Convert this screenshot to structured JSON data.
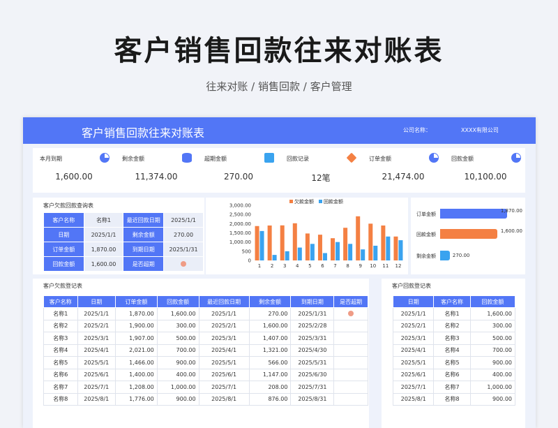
{
  "hero": {
    "title": "客户销售回款往来对账表",
    "subtitle": "往来对账 / 销售回款 / 客户管理"
  },
  "banner": {
    "title": "客户销售回款往来对账表",
    "company_label": "公司名称：",
    "company_value": "XXXX有限公司"
  },
  "colors": {
    "accent": "#5276f6",
    "orange": "#f48043",
    "light_blue": "#3aa3ef",
    "overdue_dot": "#ef9c86"
  },
  "kpis": [
    {
      "label": "本月到期",
      "value": "1,600.00",
      "icon": "pie-chart-icon"
    },
    {
      "label": "剩余金额",
      "value": "11,374.00",
      "icon": "database-icon"
    },
    {
      "label": "超期金额",
      "value": "270.00",
      "icon": "clipboard-icon"
    },
    {
      "label": "回款记录",
      "value": "12笔",
      "icon": "box-icon"
    },
    {
      "label": "订单金额",
      "value": "21,474.00",
      "icon": "pie-chart-icon"
    },
    {
      "label": "回款金额",
      "value": "10,100.00",
      "icon": "pie-chart-icon"
    }
  ],
  "query": {
    "title": "客户欠款回款查询表",
    "rows": [
      [
        "客户名称",
        "名称1",
        "最近回款日期",
        "2025/1/1"
      ],
      [
        "日期",
        "2025/1/1",
        "剩余金额",
        "270.00"
      ],
      [
        "订单金额",
        "1,870.00",
        "到期日期",
        "2025/1/31"
      ],
      [
        "回款金额",
        "1,600.00",
        "是否超期",
        ""
      ]
    ]
  },
  "chart_data": [
    {
      "type": "bar",
      "title": "",
      "legend_position": "top",
      "categories": [
        "1",
        "2",
        "3",
        "4",
        "5",
        "6",
        "7",
        "8",
        "9",
        "10",
        "11",
        "12"
      ],
      "series": [
        {
          "name": "欠款金额",
          "color": "#f48043",
          "values": [
            1870,
            1900,
            1907,
            2021,
            1466,
            1400,
            1208,
            1776,
            2400,
            2000,
            1900,
            1300
          ]
        },
        {
          "name": "回款金额",
          "color": "#3aa3ef",
          "values": [
            1600,
            300,
            500,
            700,
            900,
            400,
            1000,
            900,
            600,
            800,
            1300,
            1100
          ]
        }
      ],
      "yticks": [
        "0",
        "500",
        "1,000.00",
        "1,500.00",
        "2,000.00",
        "2,500.00",
        "3,000.00"
      ],
      "ylim": [
        0,
        3000
      ],
      "grid": false
    },
    {
      "type": "bar",
      "orientation": "horizontal",
      "categories": [
        "订单金额",
        "回款金额",
        "剩余金额"
      ],
      "values": [
        1870,
        1600,
        270
      ],
      "value_labels": [
        "1,870.00",
        "1,600.00",
        "270.00"
      ],
      "colors": [
        "#5276f6",
        "#f48043",
        "#3aa3ef"
      ],
      "xlim": [
        0,
        1870
      ]
    }
  ],
  "list_table": {
    "title": "客户欠款登记表",
    "columns": [
      "客户名称",
      "日期",
      "订单金额",
      "回款金额",
      "最近回款日期",
      "剩余金额",
      "到期日期",
      "是否超期"
    ],
    "rows": [
      [
        "名称1",
        "2025/1/1",
        "1,870.00",
        "1,600.00",
        "2025/1/1",
        "270.00",
        "2025/1/31",
        "●"
      ],
      [
        "名称2",
        "2025/2/1",
        "1,900.00",
        "300.00",
        "2025/2/1",
        "1,600.00",
        "2025/2/28",
        ""
      ],
      [
        "名称3",
        "2025/3/1",
        "1,907.00",
        "500.00",
        "2025/3/1",
        "1,407.00",
        "2025/3/31",
        ""
      ],
      [
        "名称4",
        "2025/4/1",
        "2,021.00",
        "700.00",
        "2025/4/1",
        "1,321.00",
        "2025/4/30",
        ""
      ],
      [
        "名称5",
        "2025/5/1",
        "1,466.00",
        "900.00",
        "2025/5/1",
        "566.00",
        "2025/5/31",
        ""
      ],
      [
        "名称6",
        "2025/6/1",
        "1,400.00",
        "400.00",
        "2025/6/1",
        "1,147.00",
        "2025/6/30",
        ""
      ],
      [
        "名称7",
        "2025/7/1",
        "1,208.00",
        "1,000.00",
        "2025/7/1",
        "208.00",
        "2025/7/31",
        ""
      ],
      [
        "名称8",
        "2025/8/1",
        "1,776.00",
        "900.00",
        "2025/8/1",
        "876.00",
        "2025/8/31",
        ""
      ]
    ]
  },
  "recv_table": {
    "title": "客户回款登记表",
    "columns": [
      "日期",
      "客户名称",
      "回款金额"
    ],
    "rows": [
      [
        "2025/1/1",
        "名称1",
        "1,600.00"
      ],
      [
        "2025/2/1",
        "名称2",
        "300.00"
      ],
      [
        "2025/3/1",
        "名称3",
        "500.00"
      ],
      [
        "2025/4/1",
        "名称4",
        "700.00"
      ],
      [
        "2025/5/1",
        "名称5",
        "900.00"
      ],
      [
        "2025/6/1",
        "名称6",
        "400.00"
      ],
      [
        "2025/7/1",
        "名称7",
        "1,000.00"
      ],
      [
        "2025/8/1",
        "名称8",
        "900.00"
      ]
    ]
  }
}
